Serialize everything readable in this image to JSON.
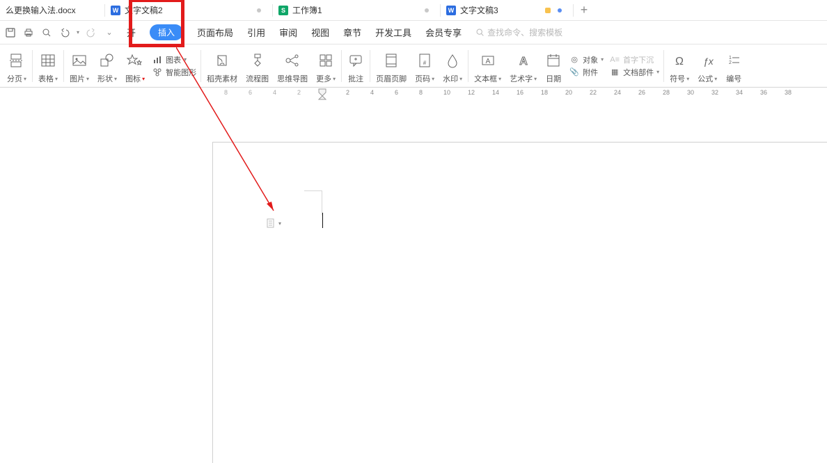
{
  "tabs": [
    {
      "label": "么更换输入法.docx",
      "icon": ""
    },
    {
      "label": "文字文稿2",
      "icon": "word",
      "modified": true
    },
    {
      "label": "工作簿1",
      "icon": "sheet",
      "modified": true
    },
    {
      "label": "文字文稿3",
      "icon": "word",
      "active": true
    }
  ],
  "menu": {
    "items": [
      "开始",
      "插入",
      "页面布局",
      "引用",
      "审阅",
      "视图",
      "章节",
      "开发工具",
      "会员专享"
    ],
    "active_index": 1,
    "search_placeholder": "查找命令、搜索模板",
    "first_partial": "开"
  },
  "ribbon": [
    {
      "label": "分页",
      "icon": "page-break",
      "dd": true
    },
    {
      "label": "表格",
      "icon": "table",
      "dd": true,
      "sep": true
    },
    {
      "label": "图片",
      "icon": "picture",
      "dd": true
    },
    {
      "label": "形状",
      "icon": "shapes",
      "dd": true
    },
    {
      "label": "图标",
      "icon": "icons",
      "dd": true,
      "red": true
    },
    {
      "label": "智能图形",
      "icon": "smartart",
      "stacked_with": "图表",
      "sep": true
    },
    {
      "label": "稻壳素材",
      "icon": "docer"
    },
    {
      "label": "流程图",
      "icon": "flowchart"
    },
    {
      "label": "思维导图",
      "icon": "mindmap"
    },
    {
      "label": "更多",
      "icon": "more",
      "dd": true,
      "sep": true
    },
    {
      "label": "批注",
      "icon": "comment",
      "sep": true
    },
    {
      "label": "页眉页脚",
      "icon": "headerfooter"
    },
    {
      "label": "页码",
      "icon": "pagenum",
      "dd": true
    },
    {
      "label": "水印",
      "icon": "watermark",
      "dd": true,
      "sep": true
    },
    {
      "label": "文本框",
      "icon": "textbox",
      "dd": true
    },
    {
      "label": "艺术字",
      "icon": "wordart",
      "dd": true
    },
    {
      "label": "日期",
      "icon": "date"
    }
  ],
  "ribbon_right": [
    {
      "label": "对象",
      "icon": "object",
      "dd": true
    },
    {
      "label": "附件",
      "icon": "attach"
    },
    {
      "label": "首字下沉",
      "icon": "dropcap",
      "disabled": true
    },
    {
      "label": "文档部件",
      "icon": "quickparts",
      "dd": true
    }
  ],
  "ribbon_far": [
    {
      "label": "符号",
      "icon": "symbol",
      "dd": true
    },
    {
      "label": "公式",
      "icon": "equation",
      "dd": true
    },
    {
      "label": "编号",
      "icon": "numbering"
    }
  ],
  "ruler": {
    "negatives": [
      "8",
      "6",
      "4",
      "2"
    ],
    "positives": [
      "2",
      "4",
      "6",
      "8",
      "10",
      "12",
      "14",
      "16",
      "18",
      "20",
      "22",
      "24",
      "26",
      "28",
      "30",
      "32",
      "34",
      "36",
      "38"
    ]
  },
  "chart_dropdown_label": "图表"
}
